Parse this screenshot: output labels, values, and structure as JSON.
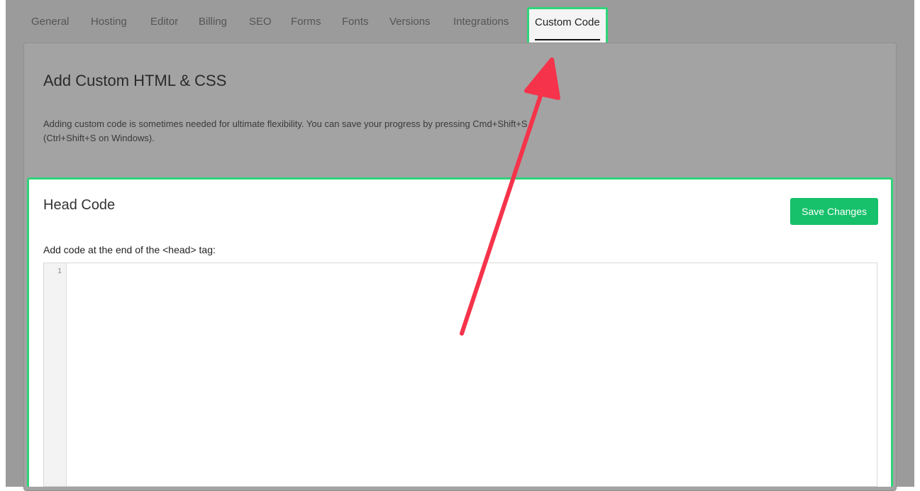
{
  "tabs": [
    {
      "label": "General"
    },
    {
      "label": "Hosting"
    },
    {
      "label": "Editor"
    },
    {
      "label": "Billing"
    },
    {
      "label": "SEO"
    },
    {
      "label": "Forms"
    },
    {
      "label": "Fonts"
    },
    {
      "label": "Versions"
    },
    {
      "label": "Integrations"
    },
    {
      "label": "Custom Code",
      "active": true
    }
  ],
  "section": {
    "title": "Add Custom HTML & CSS",
    "description": "Adding custom code is sometimes needed for ultimate flexibility. You can save your progress by pressing Cmd+Shift+S (Ctrl+Shift+S on Windows)."
  },
  "head_code": {
    "title": "Head Code",
    "save_label": "Save Changes",
    "field_label": "Add code at the end of the <head> tag:",
    "line_number": "1",
    "value": ""
  },
  "colors": {
    "highlight": "#2ed47a",
    "save_button": "#17c06a",
    "arrow": "#f5334a",
    "overlay": "#9b9b9b"
  }
}
